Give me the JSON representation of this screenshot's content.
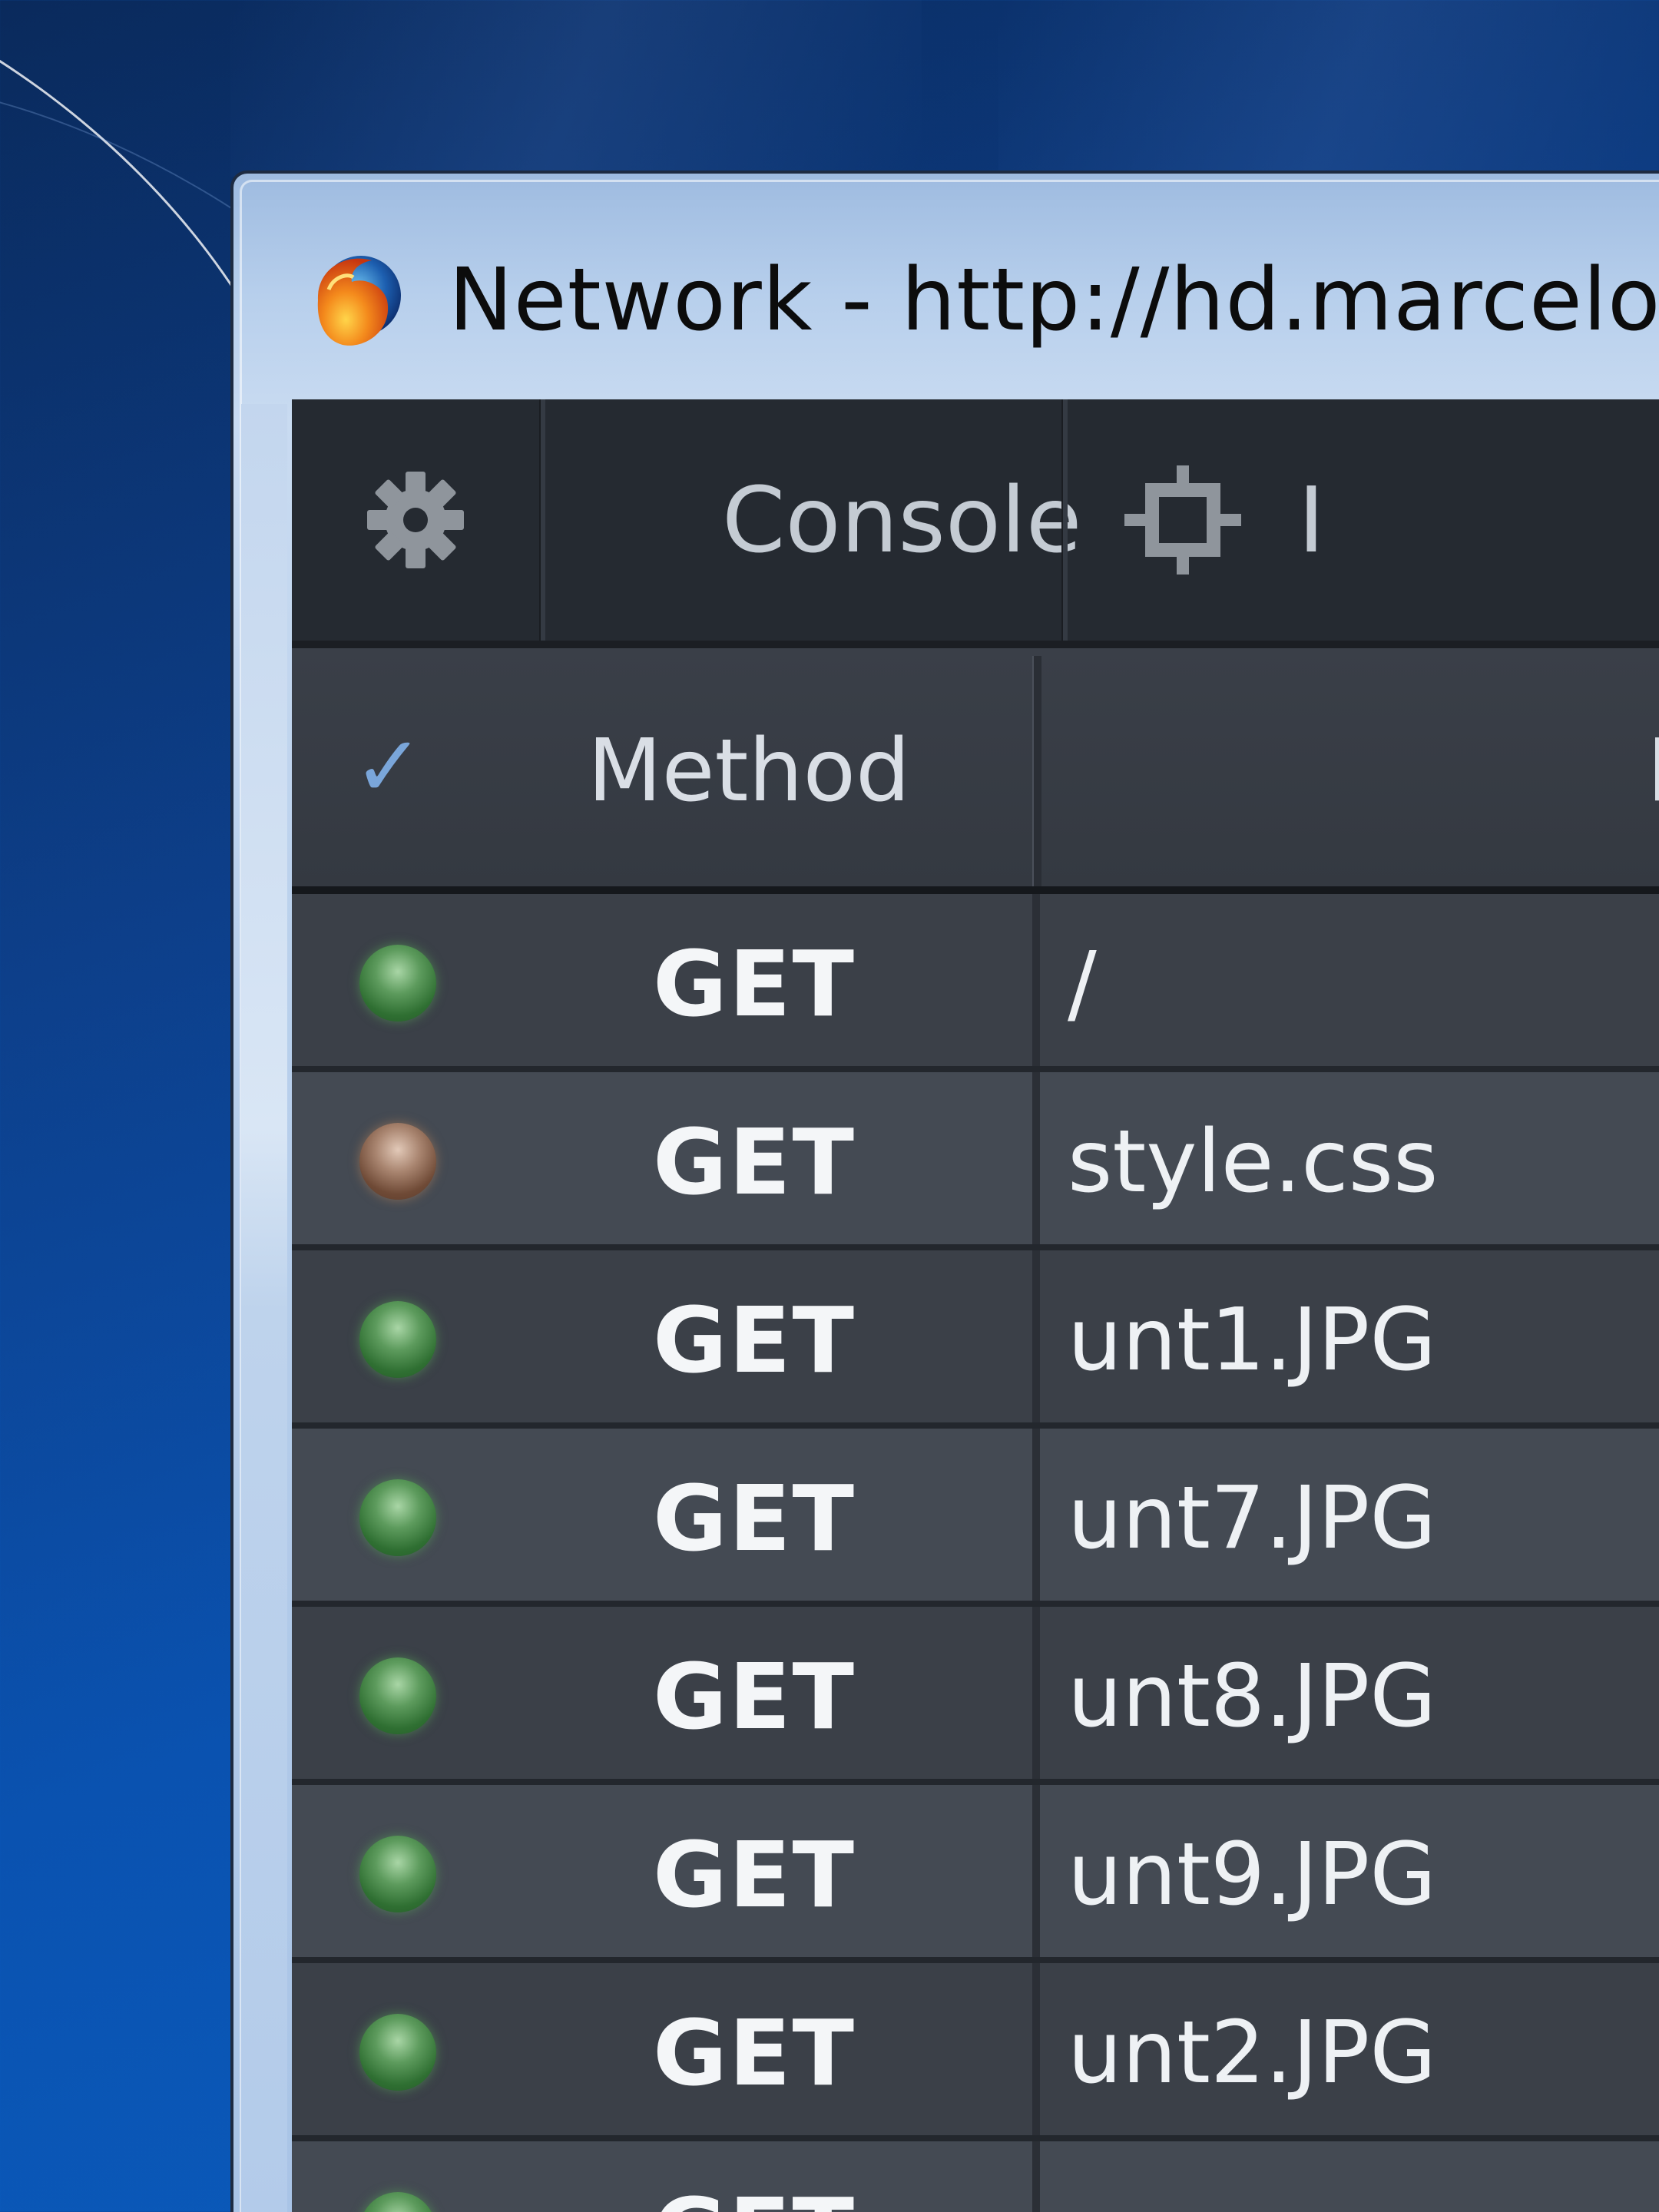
{
  "window": {
    "title": "Network - http://hd.marceloe"
  },
  "toolbar": {
    "settings_icon": "gear-icon",
    "tabs": [
      {
        "label": "Console",
        "icon": "console-chevron-icon"
      },
      {
        "label": "I",
        "icon": "inspector-crosshair-icon"
      }
    ]
  },
  "table": {
    "check_mark": "✓",
    "headers": {
      "method": "Method",
      "next": "F"
    },
    "rows": [
      {
        "status": "green",
        "method": "GET",
        "file": "/"
      },
      {
        "status": "brown",
        "method": "GET",
        "file": "style.css"
      },
      {
        "status": "green",
        "method": "GET",
        "file": "unt1.JPG"
      },
      {
        "status": "green",
        "method": "GET",
        "file": "unt7.JPG"
      },
      {
        "status": "green",
        "method": "GET",
        "file": "unt8.JPG"
      },
      {
        "status": "green",
        "method": "GET",
        "file": "unt9.JPG"
      },
      {
        "status": "green",
        "method": "GET",
        "file": "unt2.JPG"
      },
      {
        "status": "green",
        "method": "GET",
        "file": ""
      }
    ]
  },
  "colors": {
    "status_ok": "#3f8a42",
    "status_cached": "#8a6450",
    "devtools_bg": "#2b2f37"
  }
}
